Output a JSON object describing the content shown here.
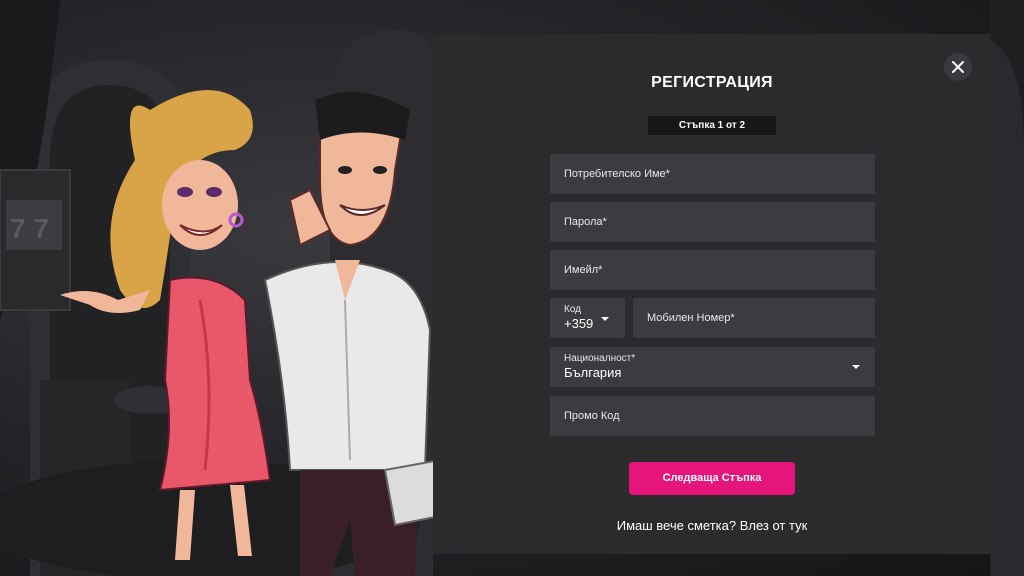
{
  "modal": {
    "title": "РЕГИСТРАЦИЯ",
    "step_badge": "Стъпка 1 от 2",
    "close_icon": "close-icon"
  },
  "form": {
    "username_placeholder": "Потребителско Име*",
    "password_placeholder": "Парола*",
    "email_placeholder": "Имейл*",
    "code_label": "Код",
    "code_value": "+359",
    "mobile_placeholder": "Мобилен Номер*",
    "nationality_label": "Националност*",
    "nationality_value": "България",
    "promo_placeholder": "Промо Код"
  },
  "actions": {
    "next_button": "Следваща Стъпка",
    "login_prompt": "Имаш вече сметка? Влез от тук"
  },
  "colors": {
    "accent": "#e5157b",
    "modal_bg": "#2b2b2e",
    "field_bg": "#3c3c40"
  }
}
